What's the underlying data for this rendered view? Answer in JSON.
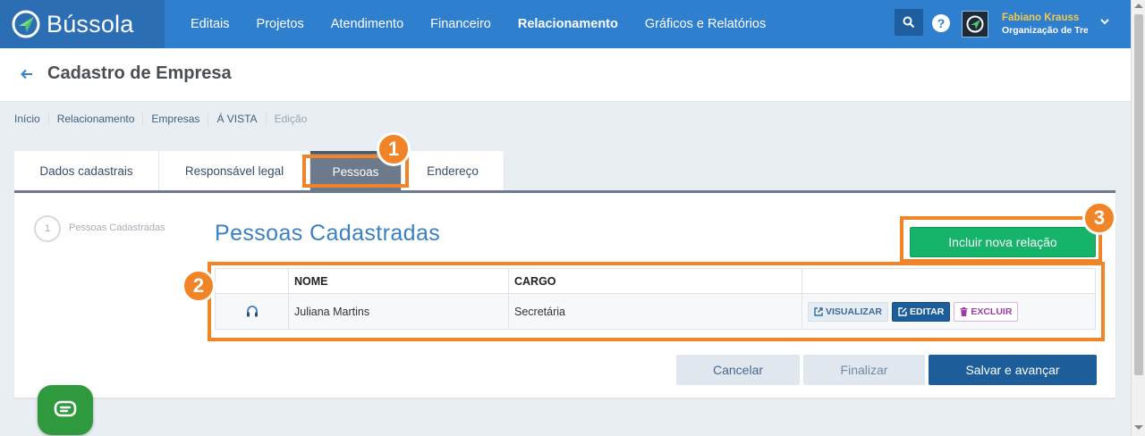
{
  "brand": {
    "name": "Bússola"
  },
  "nav": {
    "items": [
      {
        "label": "Editais"
      },
      {
        "label": "Projetos"
      },
      {
        "label": "Atendimento"
      },
      {
        "label": "Financeiro"
      },
      {
        "label": "Relacionamento"
      },
      {
        "label": "Gráficos e Relatórios"
      }
    ],
    "active_item": "Relacionamento"
  },
  "user": {
    "name": "Fabiano Krauss",
    "organization": "Organização de Tre"
  },
  "page": {
    "title": "Cadastro de Empresa"
  },
  "breadcrumb": [
    {
      "label": "Início"
    },
    {
      "label": "Relacionamento"
    },
    {
      "label": "Empresas"
    },
    {
      "label": "Á VISTA"
    },
    {
      "label": "Edição"
    }
  ],
  "tabs": [
    {
      "label": "Dados cadastrais"
    },
    {
      "label": "Responsável legal"
    },
    {
      "label": "Pessoas"
    },
    {
      "label": "Endereço"
    }
  ],
  "active_tab": "Pessoas",
  "steps": [
    {
      "number": "1",
      "label": "Pessoas Cadastradas"
    }
  ],
  "section": {
    "title": "Pessoas Cadastradas",
    "add_button": "Incluir nova relação"
  },
  "table": {
    "columns": [
      "",
      "NOME",
      "CARGO",
      ""
    ],
    "rows": [
      {
        "icon": "headset-icon",
        "nome": "Juliana Martins",
        "cargo": "Secretária"
      }
    ],
    "actions": {
      "view": "VISUALIZAR",
      "edit": "EDITAR",
      "delete": "EXCLUIR"
    }
  },
  "footer_buttons": {
    "cancel": "Cancelar",
    "finish": "Finalizar",
    "save": "Salvar e avançar"
  },
  "annotations": [
    {
      "number": "1"
    },
    {
      "number": "2"
    },
    {
      "number": "3"
    }
  ],
  "colors": {
    "navbar": "#2f7fcf",
    "brand_bg": "#2b6eb4",
    "primary": "#1d5d99",
    "success": "#16b36b",
    "annotation": "#f08426",
    "chat": "#2e9a3d"
  }
}
